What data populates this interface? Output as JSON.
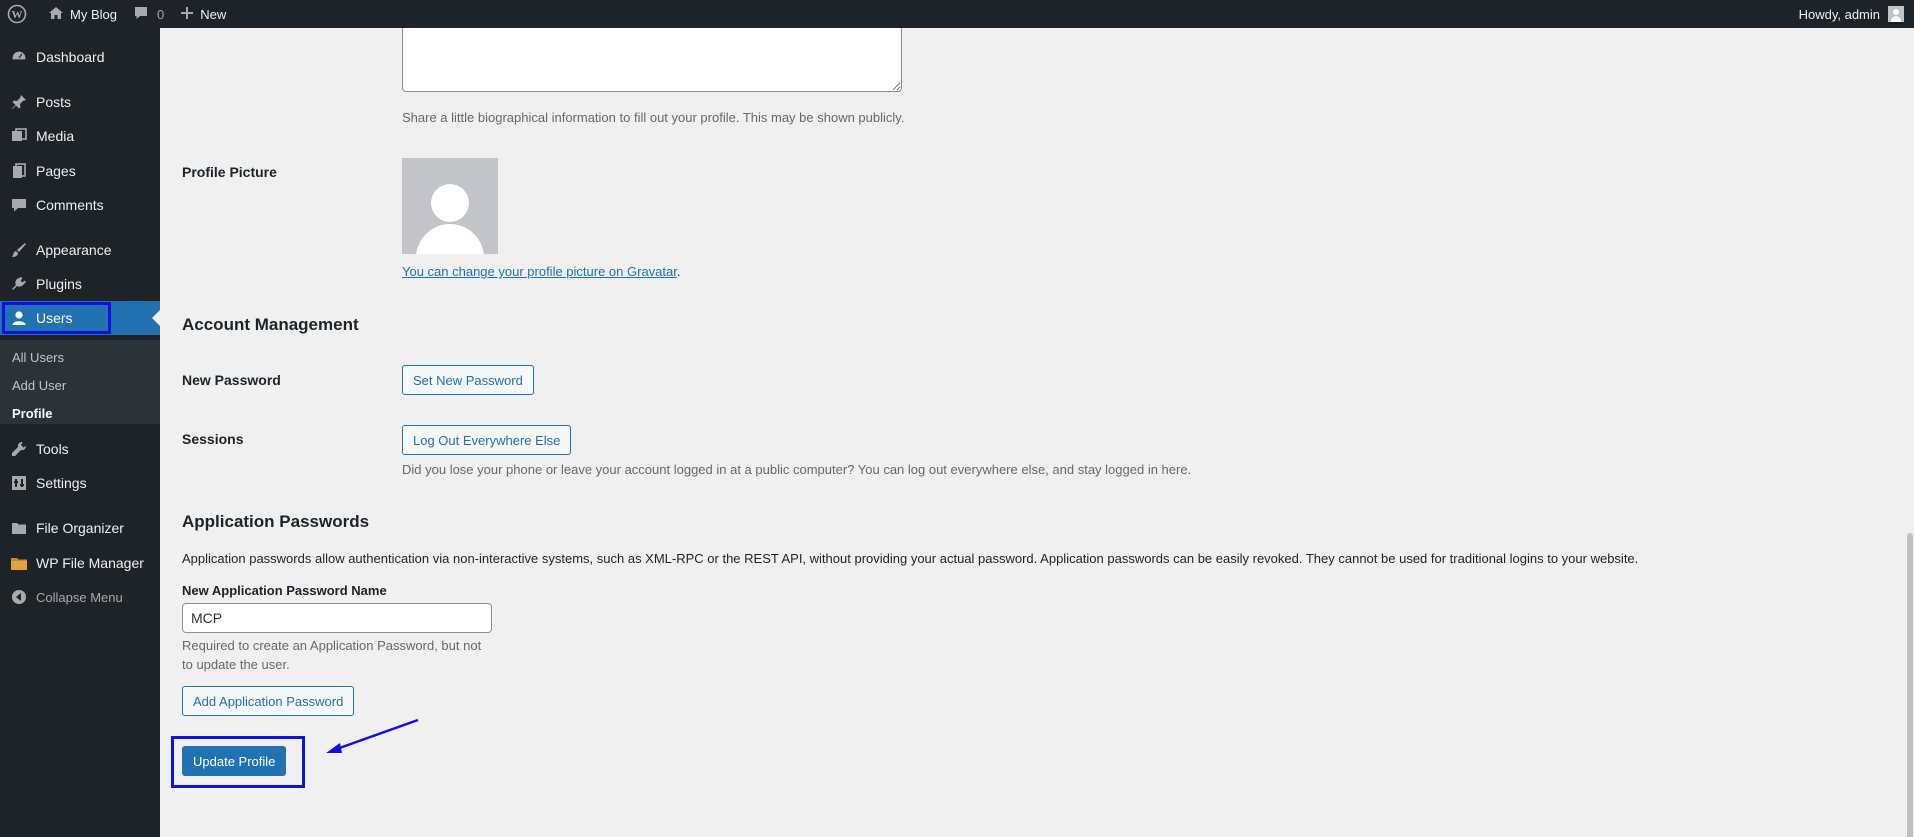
{
  "adminbar": {
    "site_name": "My Blog",
    "comments_count": "0",
    "new_label": "New",
    "howdy": "Howdy, admin"
  },
  "sidebar": {
    "items": [
      {
        "label": "Dashboard",
        "icon": "dashboard-icon"
      },
      {
        "label": "Posts",
        "icon": "pin-icon"
      },
      {
        "label": "Media",
        "icon": "media-icon"
      },
      {
        "label": "Pages",
        "icon": "pages-icon"
      },
      {
        "label": "Comments",
        "icon": "comment-icon"
      },
      {
        "label": "Appearance",
        "icon": "brush-icon"
      },
      {
        "label": "Plugins",
        "icon": "plug-icon"
      },
      {
        "label": "Users",
        "icon": "user-icon"
      },
      {
        "label": "Tools",
        "icon": "wrench-icon"
      },
      {
        "label": "Settings",
        "icon": "settings-icon"
      },
      {
        "label": "File Organizer",
        "icon": "folder-icon"
      },
      {
        "label": "WP File Manager",
        "icon": "file-manager-icon"
      },
      {
        "label": "Collapse Menu",
        "icon": "collapse-icon"
      }
    ],
    "submenu": [
      "All Users",
      "Add User",
      "Profile"
    ]
  },
  "profile": {
    "bio_description": "Share a little biographical information to fill out your profile. This may be shown publicly.",
    "picture_label": "Profile Picture",
    "gravatar_link": "You can change your profile picture on Gravatar",
    "gravatar_suffix": "."
  },
  "account": {
    "heading": "Account Management",
    "new_password_label": "New Password",
    "set_password_button": "Set New Password",
    "sessions_label": "Sessions",
    "logout_button": "Log Out Everywhere Else",
    "sessions_description": "Did you lose your phone or leave your account logged in at a public computer? You can log out everywhere else, and stay logged in here."
  },
  "app_passwords": {
    "heading": "Application Passwords",
    "description": "Application passwords allow authentication via non-interactive systems, such as XML-RPC or the REST API, without providing your actual password. Application passwords can be easily revoked. They cannot be used for traditional logins to your website.",
    "name_label": "New Application Password Name",
    "name_value": "MCP",
    "help_line1": "Required to create an Application Password, but not",
    "help_line2": "to update the user.",
    "add_button": "Add Application Password"
  },
  "submit": {
    "update_button": "Update Profile"
  },
  "colors": {
    "accent": "#2271b1",
    "admin_dark": "#1d2327",
    "annotation": "#1010e0"
  }
}
